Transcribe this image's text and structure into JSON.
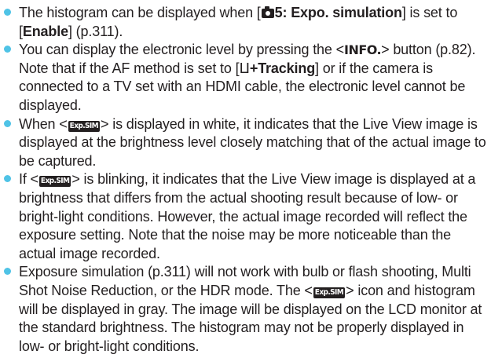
{
  "colors": {
    "bullet": "#4fc3e6",
    "text": "#231f20",
    "background": "#ffffff"
  },
  "icons": {
    "camera_tab": "camera-icon",
    "face_tracking": "face-tracking-icon",
    "exposure_sim": "exp-sim-icon"
  },
  "bullets": {
    "b1": {
      "t1": "The histogram can be displayed when [",
      "menu_setting": "5: Expo. simulation",
      "t2": "] is set to [",
      "value": "Enable",
      "t3": "] (p.311)."
    },
    "b2": {
      "t1": "You can display the electronic level by pressing the <",
      "button": "INFO.",
      "t2": "> button (p.82). Note that if the AF method is set to [",
      "af_glyph": "ⵡ",
      "af_method": "+Tracking",
      "t3": "] or if the camera is connected to a TV set with an HDMI cable, the electronic level cannot be displayed."
    },
    "b3": {
      "t1": "When <",
      "icon_label": "Exp.SIM",
      "t2": "> is displayed in white, it indicates that the Live View image is displayed at the brightness level closely matching that of the actual image to be captured."
    },
    "b4": {
      "t1": "If <",
      "icon_label": "Exp.SIM",
      "t2": "> is blinking, it indicates that the Live View image is displayed at a brightness that differs from the actual shooting result because of low- or bright-light conditions. However, the actual image recorded will reflect the exposure setting. Note that the noise may be more noticeable than the actual image recorded."
    },
    "b5": {
      "t1": "Exposure simulation (p.311) will not work with bulb or flash shooting, Multi Shot Noise Reduction, or the HDR mode. The <",
      "icon_label": "Exp.SIM",
      "t2": "> icon and histogram will be displayed in gray. The image will be displayed on the LCD monitor at the standard brightness. The histogram may not be properly displayed in low- or bright-light conditions."
    }
  }
}
